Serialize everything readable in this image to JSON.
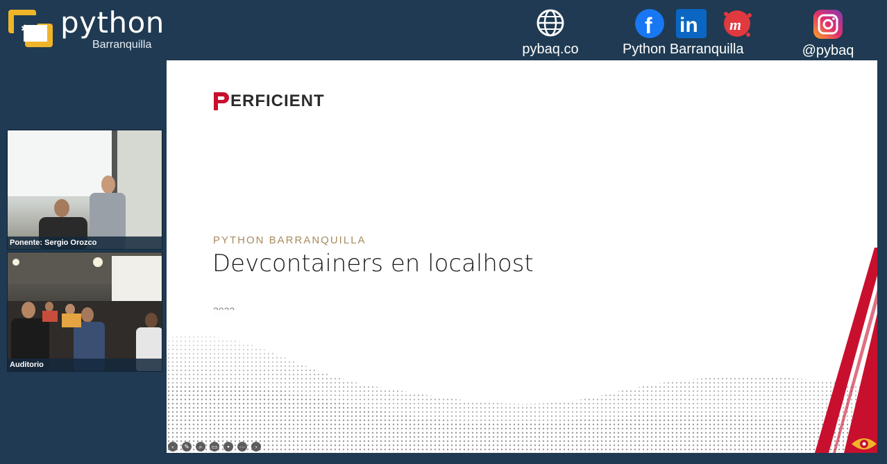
{
  "brand": {
    "name": "python",
    "city": "Barranquilla"
  },
  "social": {
    "website": "pybaq.co",
    "group_name": "Python Barranquilla",
    "instagram": "@pybaq",
    "icons": [
      "globe-icon",
      "facebook-icon",
      "linkedin-icon",
      "meetup-icon",
      "instagram-icon"
    ],
    "colors": {
      "facebook": "#1877f2",
      "linkedin": "#0a66c2",
      "meetup": "#e0393e"
    }
  },
  "videos": {
    "speaker_caption": "Ponente: Sergio Orozco",
    "audience_caption": "Auditorio"
  },
  "slide": {
    "company": "ERFICIENT",
    "eyebrow": "PYTHON BARRANQUILLA",
    "title": "Devcontainers en localhost",
    "year": "2023",
    "accent_red": "#c8102e"
  }
}
